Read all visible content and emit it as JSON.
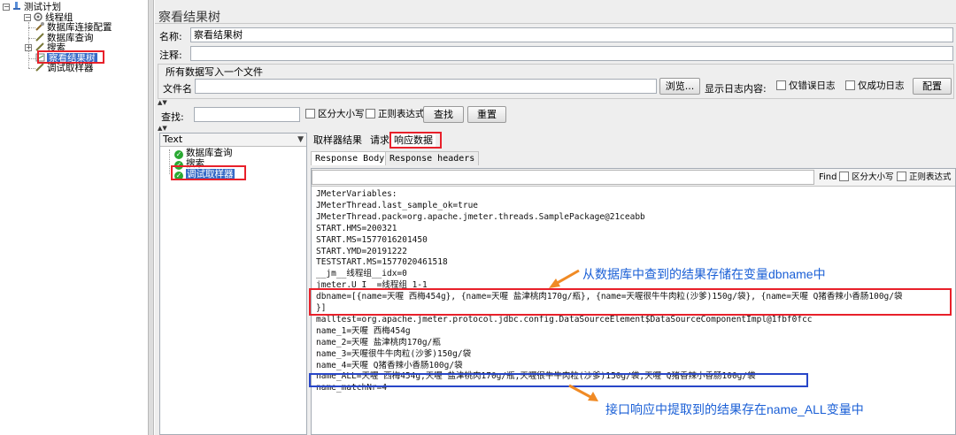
{
  "test_plan_tree": {
    "root": "测试计划",
    "thread_group": "线程组",
    "items": [
      "数据库连接配置",
      "数据库查询",
      "搜索",
      "察看结果树",
      "调试取样器"
    ]
  },
  "listener": {
    "title": "察看结果树",
    "name_label": "名称:",
    "name_value": "察看结果树",
    "comment_label": "注释:",
    "comment_value": "",
    "write_all_label": "所有数据写入一个文件",
    "filename_label": "文件名",
    "filename_value": "",
    "browse_button": "浏览...",
    "log_content_label": "显示日志内容:",
    "errors_only": "仅错误日志",
    "success_only": "仅成功日志",
    "config_button": "配置"
  },
  "search": {
    "label": "查找:",
    "value": "",
    "case_sensitive": "区分大小写",
    "regex": "正则表达式",
    "find_button": "查找",
    "reset_button": "重置"
  },
  "results": {
    "renderer": "Text",
    "samples": [
      "数据库查询",
      "搜索",
      "调试取样器"
    ],
    "tabs": [
      "取样器结果",
      "请求",
      "响应数据"
    ],
    "subtabs": [
      "Response Body",
      "Response headers"
    ],
    "find_label": "Find",
    "find_case": "区分大小写",
    "find_regex": "正则表达式",
    "body_lines": [
      "JMeterVariables:",
      "JMeterThread.last_sample_ok=true",
      "JMeterThread.pack=org.apache.jmeter.threads.SamplePackage@21ceabb",
      "START.HMS=200321",
      "START.MS=1577016201450",
      "START.YMD=20191222",
      "TESTSTART.MS=1577020461518",
      "__jm__线程组__idx=0",
      "  jmeter.U_I__=线程组 1-1",
      "dbname=[{name=天喔 西梅454g}, {name=天喔 盐津桃肉170g/瓶}, {name=天喔很牛牛肉粒(沙爹)150g/袋}, {name=天喔 Q猪香辣小香肠100g/袋",
      "}]",
      "malltest=org.apache.jmeter.protocol.jdbc.config.DataSourceElement$DataSourceComponentImpl@1fbf0fcc",
      "name_1=天喔 西梅454g",
      "name_2=天喔 盐津桃肉170g/瓶",
      "name_3=天喔很牛牛肉粒(沙爹)150g/袋",
      "name_4=天喔 Q猪香辣小香肠100g/袋",
      "name_ALL=天喔 西梅454g,天喔 盐津桃肉170g/瓶,天喔很牛牛肉粒(沙爹)150g/袋,天喔 Q猪香辣小香肠100g/袋",
      "name_matchNr=4"
    ]
  },
  "annotations": {
    "top": "从数据库中查到的结果存储在变量dbname中",
    "bottom": "接口响应中提取到的结果存在name_ALL变量中"
  },
  "colors": {
    "highlight_red": "#e8202a",
    "highlight_blue": "#2846c8",
    "annotation_text": "#1a5fd6",
    "arrow_orange": "#f08a24",
    "selection": "#3569c6"
  }
}
